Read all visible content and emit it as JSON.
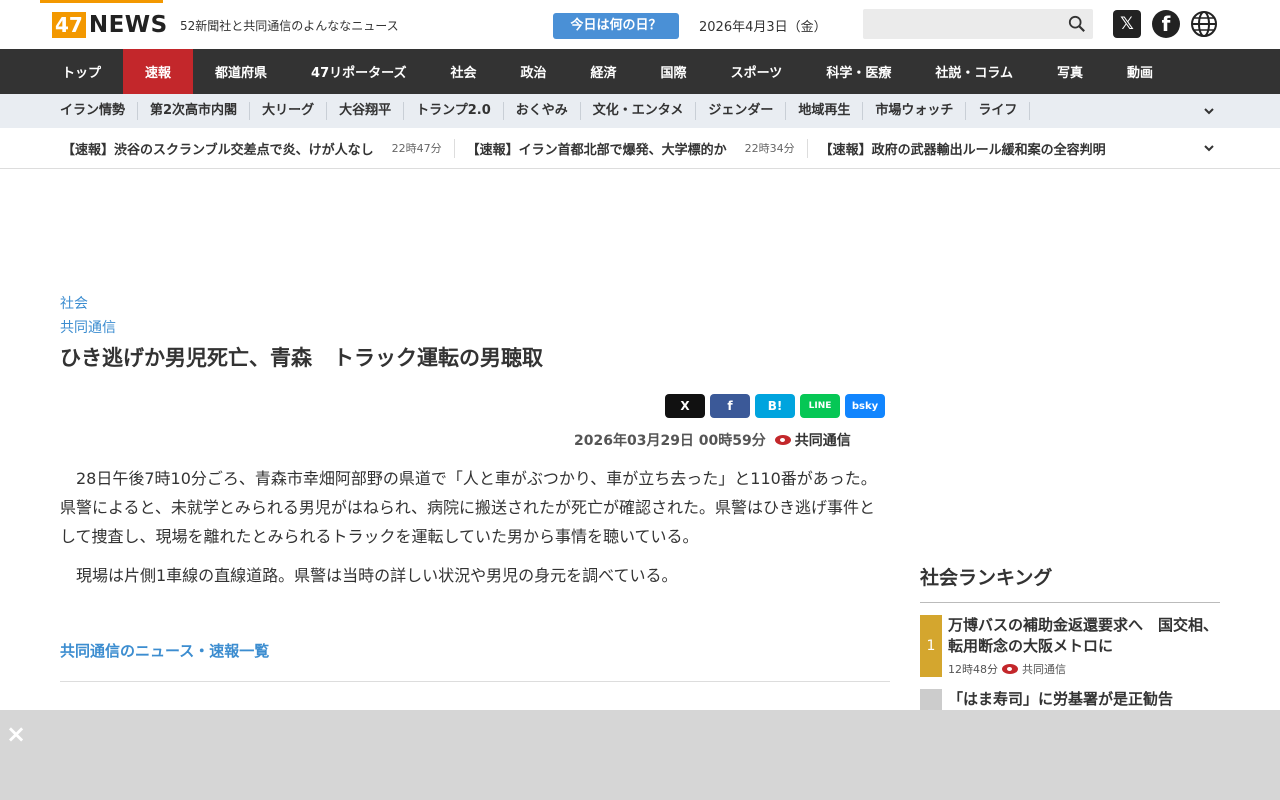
{
  "header": {
    "logo_num": "47",
    "logo_word": "NEWS",
    "tagline": "52新聞社と共同通信のよんななニュース",
    "today_button": "今日は何の日？",
    "date": "2026年4月3日（金）",
    "search_placeholder": ""
  },
  "mainnav": [
    "トップ",
    "速報",
    "都道府県",
    "47リポーターズ",
    "社会",
    "政治",
    "経済",
    "国際",
    "スポーツ",
    "科学・医療",
    "社説・コラム",
    "写真",
    "動画"
  ],
  "subnav": [
    "イラン情勢",
    "第2次高市内閣",
    "大リーグ",
    "大谷翔平",
    "トランプ2.0",
    "おくやみ",
    "文化・エンタメ",
    "ジェンダー",
    "地域再生",
    "市場ウォッチ",
    "ライフ"
  ],
  "breaking": [
    {
      "text": "【速報】渋谷のスクランブル交差点で炎、けが人なし",
      "time": "22時47分"
    },
    {
      "text": "【速報】イラン首都北部で爆発、大学標的か",
      "time": "22時34分"
    },
    {
      "text": "【速報】政府の武器輸出ルール緩和案の全容判明",
      "time": ""
    }
  ],
  "article": {
    "category": "社会",
    "source": "共同通信",
    "title": "ひき逃げか男児死亡、青森　トラック運転の男聴取",
    "share": [
      "X",
      "f",
      "B!",
      "LINE",
      "bsky"
    ],
    "datetime": "2026年03月29日 00時59分",
    "publisher": "共同通信",
    "paragraphs": [
      "28日午後7時10分ごろ、青森市幸畑阿部野の県道で「人と車がぶつかり、車が立ち去った」と110番があった。県警によると、未就学とみられる男児がはねられ、病院に搬送されたが死亡が確認された。県警はひき逃げ事件として捜査し、現場を離れたとみられるトラックを運転していた男から事情を聴いている。",
      "現場は片側1車線の直線道路。県警は当時の詳しい状況や男児の身元を調べている。"
    ],
    "more_link": "共同通信のニュース・速報一覧"
  },
  "ranking": {
    "heading": "社会ランキング",
    "items": [
      {
        "rank": "1",
        "title": "万博バスの補助金返還要求へ　国交相、転用断念の大阪メトロに",
        "time": "12時48分",
        "publisher": "共同通信"
      },
      {
        "rank": "",
        "title": "「はま寿司」に労基署が是正勧告",
        "time": "",
        "publisher": ""
      }
    ]
  },
  "overlay": {
    "close": "×"
  },
  "colors": {
    "brand": "#f39800",
    "accent_red": "#c3272b",
    "link": "#3c8dd0",
    "nav_bg": "#333333"
  }
}
